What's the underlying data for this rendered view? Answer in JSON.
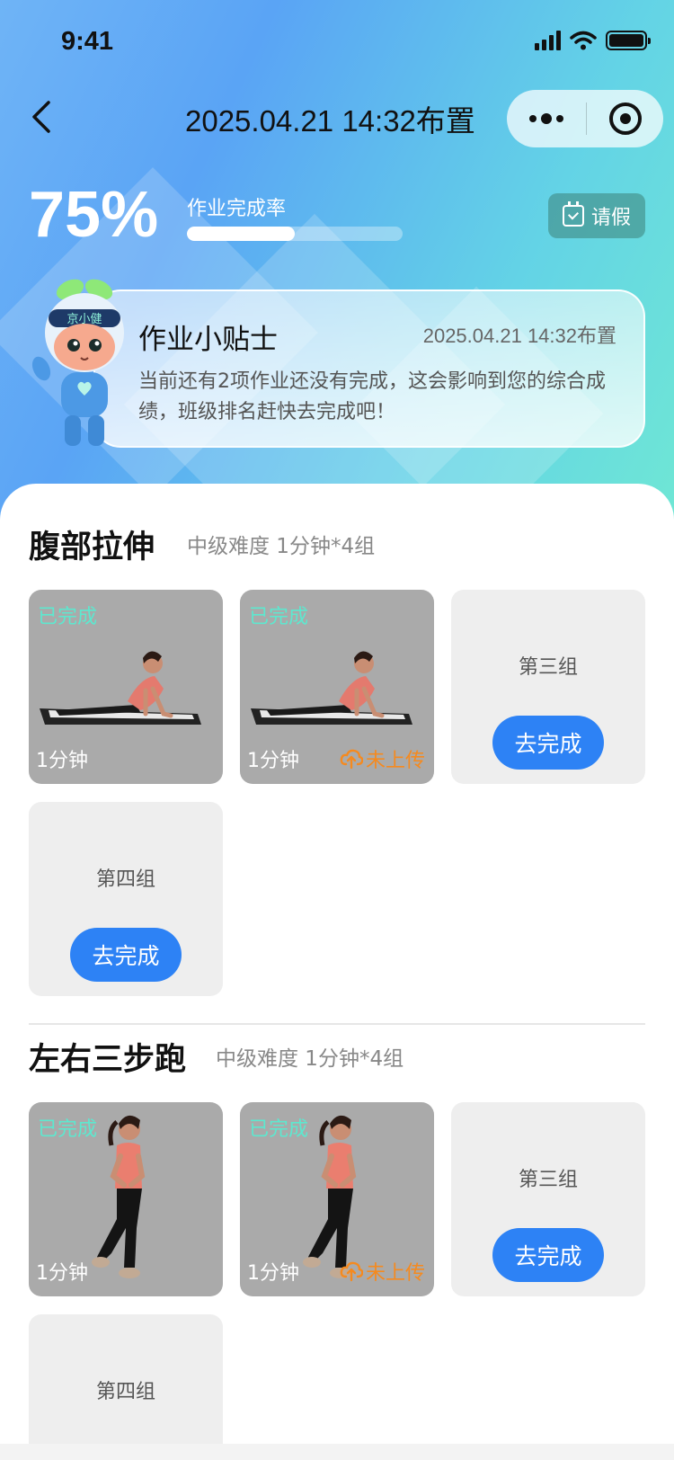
{
  "status_bar": {
    "time": "9:41"
  },
  "nav": {
    "title": "2025.04.21 14:32布置"
  },
  "progress": {
    "rate_text": "75%",
    "label": "作业完成率",
    "value": 0.5
  },
  "leave_button": {
    "label": "请假"
  },
  "tip": {
    "title": "作业小贴士",
    "date": "2025.04.21 14:32布置",
    "text": "当前还有2项作业还没有完成，这会影响到您的综合成绩，班级排名赶快去完成吧！"
  },
  "mascot": {
    "badge": "京小健"
  },
  "sections": [
    {
      "title": "腹部拉伸",
      "meta": "中级难度 1分钟*4组",
      "cards": [
        {
          "state": "done",
          "status": "已完成",
          "duration": "1分钟"
        },
        {
          "state": "done",
          "status": "已完成",
          "duration": "1分钟",
          "upload": "未上传"
        },
        {
          "state": "todo",
          "label": "第三组",
          "action": "去完成"
        },
        {
          "state": "todo",
          "label": "第四组",
          "action": "去完成"
        }
      ]
    },
    {
      "title": "左右三步跑",
      "meta": "中级难度 1分钟*4组",
      "cards": [
        {
          "state": "done",
          "status": "已完成",
          "duration": "1分钟"
        },
        {
          "state": "done",
          "status": "已完成",
          "duration": "1分钟",
          "upload": "未上传"
        },
        {
          "state": "todo",
          "label": "第三组",
          "action": "去完成"
        },
        {
          "state": "todo",
          "label": "第四组"
        }
      ]
    }
  ],
  "colors": {
    "accent": "#2d82f5",
    "completed": "#5de8cf",
    "not_uploaded": "#f58a1f"
  }
}
